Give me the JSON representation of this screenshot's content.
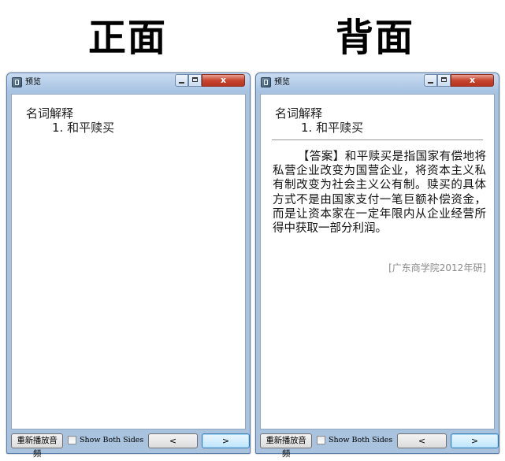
{
  "headings": {
    "front": "正面",
    "back": "背面"
  },
  "windows": [
    {
      "title": "预览",
      "card": {
        "title": "名词解释",
        "item": "1. 和平赎买"
      },
      "controls": {
        "close": "x"
      },
      "bottom": {
        "replay_label": "重新播放音频",
        "show_both_label": "Show Both Sides",
        "show_both_checked": false,
        "prev_label": "<",
        "next_label": ">"
      }
    },
    {
      "title": "预览",
      "card": {
        "title": "名词解释",
        "item": "1. 和平赎买",
        "answer": "【答案】和平赎买是指国家有偿地将私营企业改变为国营企业，将资本主义私有制改变为社会主义公有制。赎买的具体方式不是由国家支付一笔巨额补偿资金，而是让资本家在一定年限内从企业经营所得中获取一部分利润。",
        "source": "[广东商学院2012年研]"
      },
      "controls": {
        "close": "x"
      },
      "bottom": {
        "replay_label": "重新播放音频",
        "show_both_label": "Show Both Sides",
        "show_both_checked": false,
        "prev_label": "<",
        "next_label": ">"
      }
    }
  ]
}
